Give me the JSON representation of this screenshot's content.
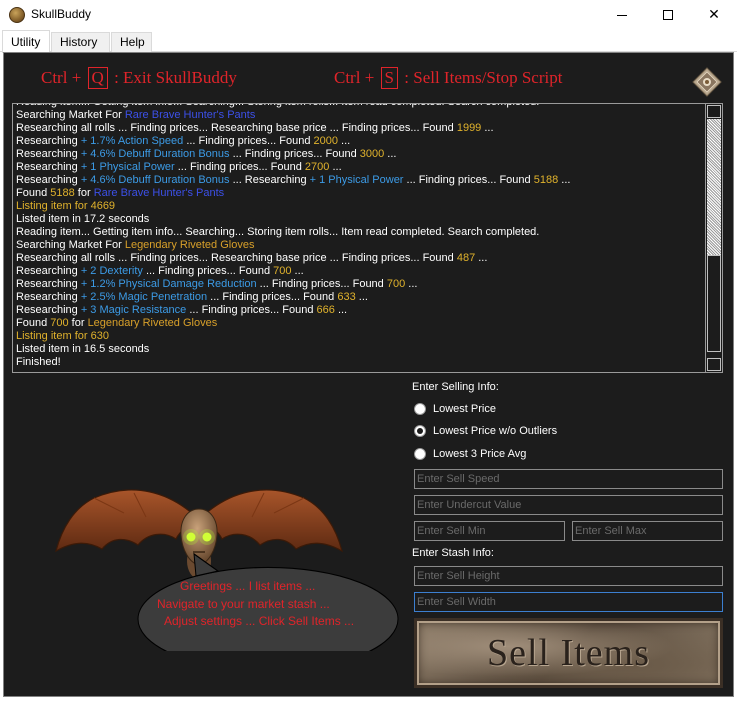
{
  "window": {
    "title": "SkullBuddy",
    "controls": {
      "minimize": "—",
      "maximize": "☐",
      "close": "✕"
    }
  },
  "tabs": [
    {
      "label": "Utility",
      "active": true
    },
    {
      "label": "History",
      "active": false
    },
    {
      "label": "Help",
      "active": false
    }
  ],
  "hotkeys": {
    "exit_ctrl": "Ctrl +",
    "exit_key": "Q",
    "exit_label": ": Exit SkullBuddy",
    "sell_ctrl": "Ctrl +",
    "sell_key": "S",
    "sell_label": ": Sell Items/Stop Script"
  },
  "log": {
    "lines": [
      [
        {
          "t": "Reading item... Getting item info... Searching... Storing item rolls... Item read completed. Search completed.",
          "c": "white"
        }
      ],
      [
        {
          "t": "Searching Market For ",
          "c": "white"
        },
        {
          "t": "Rare Brave Hunter's Pants",
          "c": "blue"
        }
      ],
      [
        {
          "t": "Researching all rolls ... Finding prices... Researching base price ... Finding prices... Found ",
          "c": "white"
        },
        {
          "t": "1999",
          "c": "gold"
        },
        {
          "t": " ...",
          "c": "white"
        }
      ],
      [
        {
          "t": "Researching ",
          "c": "white"
        },
        {
          "t": "+ 1.7% Action Speed",
          "c": "mod"
        },
        {
          "t": " ... Finding prices... Found ",
          "c": "white"
        },
        {
          "t": "2000",
          "c": "gold"
        },
        {
          "t": " ...",
          "c": "white"
        }
      ],
      [
        {
          "t": "Researching ",
          "c": "white"
        },
        {
          "t": "+ 4.6% Debuff Duration Bonus",
          "c": "mod"
        },
        {
          "t": " ... Finding prices... Found ",
          "c": "white"
        },
        {
          "t": "3000",
          "c": "gold"
        },
        {
          "t": " ...",
          "c": "white"
        }
      ],
      [
        {
          "t": "Researching ",
          "c": "white"
        },
        {
          "t": "+ 1 Physical Power",
          "c": "mod"
        },
        {
          "t": " ... Finding prices... Found ",
          "c": "white"
        },
        {
          "t": "2700",
          "c": "gold"
        },
        {
          "t": " ...",
          "c": "white"
        }
      ],
      [
        {
          "t": "Researching ",
          "c": "white"
        },
        {
          "t": "+ 4.6% Debuff Duration Bonus",
          "c": "mod"
        },
        {
          "t": " ... Researching ",
          "c": "white"
        },
        {
          "t": "+ 1 Physical Power",
          "c": "mod"
        },
        {
          "t": " ... Finding prices... Found ",
          "c": "white"
        },
        {
          "t": "5188",
          "c": "gold"
        },
        {
          "t": " ...",
          "c": "white"
        }
      ],
      [
        {
          "t": "Found ",
          "c": "white"
        },
        {
          "t": "5188",
          "c": "gold"
        },
        {
          "t": " for ",
          "c": "white"
        },
        {
          "t": "Rare Brave Hunter's Pants",
          "c": "blue"
        }
      ],
      [
        {
          "t": "Listing item for 4669",
          "c": "gold"
        }
      ],
      [
        {
          "t": "Listed item in 17.2 seconds",
          "c": "white"
        }
      ],
      [
        {
          "t": "Reading item... Getting item info... Searching... Storing item rolls... Item read completed. Search completed.",
          "c": "white"
        }
      ],
      [
        {
          "t": "Searching Market For ",
          "c": "white"
        },
        {
          "t": "Legendary Riveted Gloves",
          "c": "legend"
        }
      ],
      [
        {
          "t": "Researching all rolls ... Finding prices... Researching base price ... Finding prices... Found ",
          "c": "white"
        },
        {
          "t": "487",
          "c": "gold"
        },
        {
          "t": " ...",
          "c": "white"
        }
      ],
      [
        {
          "t": "Researching ",
          "c": "white"
        },
        {
          "t": "+ 2 Dexterity",
          "c": "mod"
        },
        {
          "t": " ... Finding prices... Found ",
          "c": "white"
        },
        {
          "t": "700",
          "c": "gold"
        },
        {
          "t": " ...",
          "c": "white"
        }
      ],
      [
        {
          "t": "Researching ",
          "c": "white"
        },
        {
          "t": "+ 1.2% Physical Damage Reduction",
          "c": "mod"
        },
        {
          "t": " ... Finding prices... Found ",
          "c": "white"
        },
        {
          "t": "700",
          "c": "gold"
        },
        {
          "t": " ...",
          "c": "white"
        }
      ],
      [
        {
          "t": "Researching ",
          "c": "white"
        },
        {
          "t": "+ 2.5% Magic Penetration",
          "c": "mod"
        },
        {
          "t": " ... Finding prices... Found ",
          "c": "white"
        },
        {
          "t": "633",
          "c": "gold"
        },
        {
          "t": " ...",
          "c": "white"
        }
      ],
      [
        {
          "t": "Researching ",
          "c": "white"
        },
        {
          "t": "+ 3 Magic Resistance",
          "c": "mod"
        },
        {
          "t": " ... Finding prices... Found ",
          "c": "white"
        },
        {
          "t": "666",
          "c": "gold"
        },
        {
          "t": " ...",
          "c": "white"
        }
      ],
      [
        {
          "t": "Found ",
          "c": "white"
        },
        {
          "t": "700",
          "c": "gold"
        },
        {
          "t": " for ",
          "c": "white"
        },
        {
          "t": "Legendary Riveted Gloves",
          "c": "legend"
        }
      ],
      [
        {
          "t": "Listing item for 630",
          "c": "gold"
        }
      ],
      [
        {
          "t": "Listed item in 16.5 seconds",
          "c": "white"
        }
      ],
      [
        {
          "t": "Finished!",
          "c": "white"
        }
      ]
    ]
  },
  "selling": {
    "heading": "Enter Selling Info:",
    "options": [
      {
        "label": "Lowest Price",
        "checked": false
      },
      {
        "label": "Lowest Price w/o Outliers",
        "checked": true
      },
      {
        "label": "Lowest 3 Price Avg",
        "checked": false
      }
    ],
    "sell_speed_placeholder": "Enter Sell Speed",
    "undercut_placeholder": "Enter Undercut Value",
    "sell_min_placeholder": "Enter Sell Min",
    "sell_max_placeholder": "Enter Sell Max"
  },
  "stash": {
    "heading": "Enter Stash Info:",
    "height_placeholder": "Enter Sell Height",
    "width_placeholder": "Enter Sell Width"
  },
  "sell_button": {
    "label": "Sell Items"
  },
  "mascot": {
    "bubble_line1": "Greetings ... I list items ...",
    "bubble_line2": "Navigate to your market stash ...",
    "bubble_line3": "Adjust settings ... Click Sell Items ..."
  },
  "colors": {
    "panel_bg": "#1c1c1c",
    "hotkey_red": "#e0242a",
    "mod_blue": "#3c9be6",
    "rare_blue": "#3c50e8",
    "gold": "#e0b22c",
    "legendary": "#d8a02a"
  }
}
